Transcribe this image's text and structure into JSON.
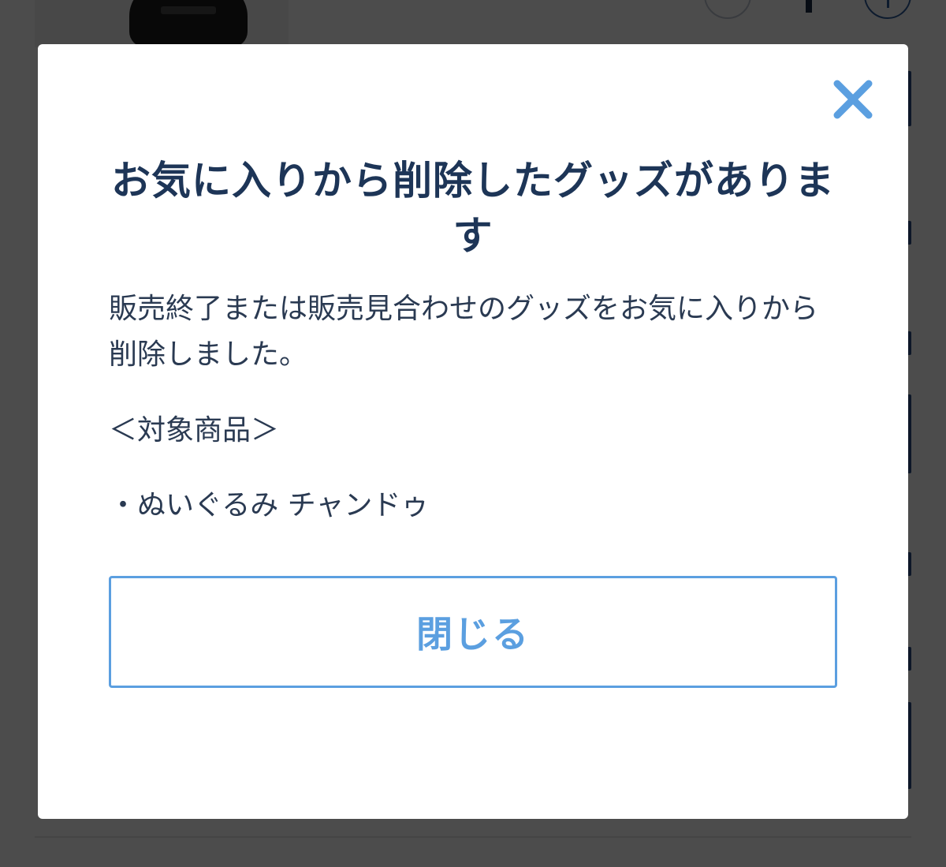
{
  "modal": {
    "title": "お気に入りから削除したグッズがあります",
    "message": "販売終了または販売見合わせのグッズをお気に入りから削除しました。",
    "target_heading": "＜対象商品＞",
    "items": [
      "・ぬいぐるみ チャンドゥ"
    ],
    "close_button_label": "閉じる",
    "close_icon": "close-x-icon"
  },
  "colors": {
    "accent": "#5b9fe0",
    "title": "#1d3557",
    "body_text": "#2a3a52",
    "overlay": "rgba(0,0,0,0.70)"
  }
}
